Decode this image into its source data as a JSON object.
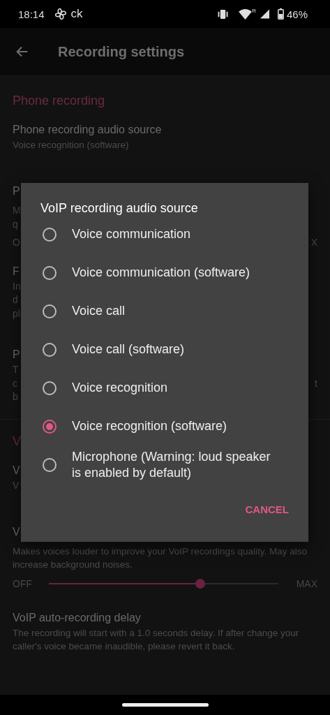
{
  "status_bar": {
    "time": "18:14",
    "notification_text": "ck",
    "roaming": "R",
    "battery": "46%"
  },
  "app_bar": {
    "title": "Recording settings"
  },
  "settings": [
    {
      "kind": "section",
      "title": "Phone recording"
    },
    {
      "kind": "pref",
      "title": "Phone recording audio source",
      "summary": "Voice recognition (software)"
    },
    {
      "kind": "pref",
      "title": "P",
      "lines": [
        {
          "text": "M"
        },
        {
          "text": "q"
        }
      ],
      "range": {
        "left": "O",
        "right": "X"
      }
    },
    {
      "kind": "pref",
      "title": "F",
      "lines": [
        {
          "text": "In"
        },
        {
          "text": "d"
        },
        {
          "text": "pl"
        }
      ]
    },
    {
      "kind": "pref",
      "title": "P",
      "lines": [
        {
          "text": "T"
        },
        {
          "text": "c",
          "end": "t"
        },
        {
          "text": "b"
        }
      ]
    },
    {
      "kind": "divider"
    },
    {
      "kind": "section",
      "title": "V"
    },
    {
      "kind": "pref",
      "title": "V",
      "lines": [
        {
          "text": "V"
        }
      ]
    },
    {
      "kind": "pref",
      "title": "V",
      "summary": "Makes voices louder to improve your VoIP recordings quality. May also increase background noises.",
      "slider": {
        "min_label": "OFF",
        "max_label": "MAX",
        "level": 0.66
      }
    },
    {
      "kind": "pref",
      "title": "VoIP auto-recording delay",
      "summary": "The recording will start with a 1.0 seconds delay. If after change your caller's voice became inaudible, please revert it back."
    }
  ],
  "dialog": {
    "title": "VoIP recording audio source",
    "options": [
      {
        "label": "Voice communication",
        "selected": false
      },
      {
        "label": "Voice communication (software)",
        "selected": false
      },
      {
        "label": "Voice call",
        "selected": false
      },
      {
        "label": "Voice call (software)",
        "selected": false
      },
      {
        "label": "Voice recognition",
        "selected": false
      },
      {
        "label": "Voice recognition (software)",
        "selected": true
      },
      {
        "label": "Microphone (Warning: loud speaker is enabled by default)",
        "selected": false
      }
    ],
    "buttons": [
      "CANCEL"
    ]
  }
}
